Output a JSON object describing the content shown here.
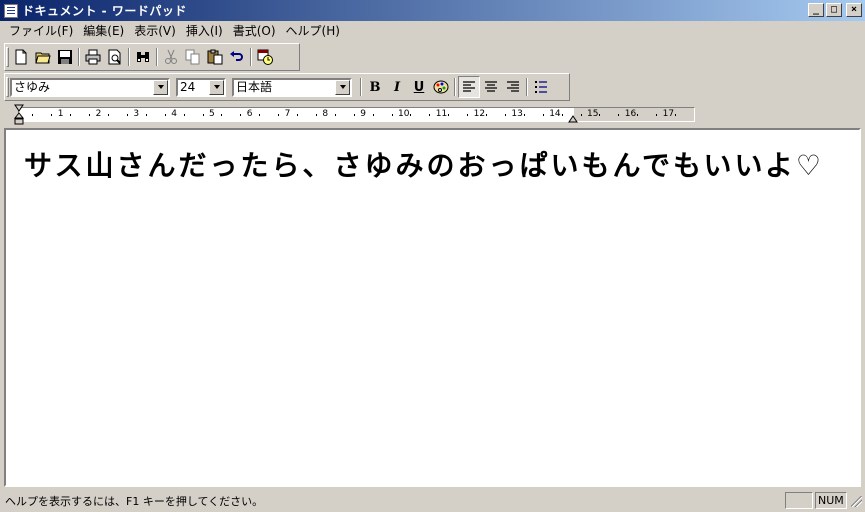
{
  "window": {
    "title": "ドキュメント - ワードパッド",
    "minimize": "_",
    "maximize": "□",
    "close": "×"
  },
  "menu": [
    "ファイル(F)",
    "編集(E)",
    "表示(V)",
    "挿入(I)",
    "書式(O)",
    "ヘルプ(H)"
  ],
  "format": {
    "font_name": "さゆみ",
    "font_size": "24",
    "script": "日本語",
    "bold": "B",
    "italic": "I",
    "underline": "U"
  },
  "ruler": {
    "numbers": [
      "1",
      "2",
      "3",
      "4",
      "5",
      "6",
      "7",
      "8",
      "9",
      "10",
      "11",
      "12",
      "13",
      "14",
      "15",
      "16",
      "17"
    ]
  },
  "document": {
    "text": "サス山さんだったら、さゆみのおっぱいもんでもいいよ♡"
  },
  "status": {
    "help_text": "ヘルプを表示するには、F1 キーを押してください。",
    "num": "NUM"
  }
}
